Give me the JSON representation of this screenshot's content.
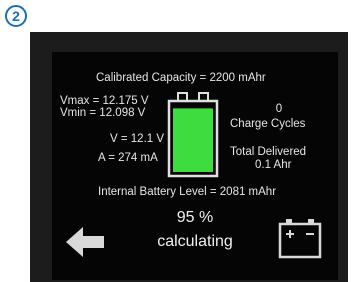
{
  "step_number": "2",
  "screen": {
    "calibrated_capacity": "Calibrated Capacity = 2200 mAhr",
    "vmax": "Vmax = 12.175 V",
    "vmin": "Vmin = 12.098 V",
    "voltage": "V = 12.1 V",
    "current": "A = 274 mA",
    "charge_cycles_count": "0",
    "charge_cycles_label": "Charge Cycles",
    "total_delivered_label": "Total Delivered",
    "total_delivered_value": "0.1 Ahr",
    "internal_level": "Internal Battery Level = 2081 mAhr",
    "percent": "95 %",
    "status": "calculating"
  },
  "battery_gauge": {
    "fill_fraction": 0.95,
    "fill_color": "#3fdc3f",
    "outline_color": "#e0e0e0"
  },
  "icons": {
    "back": "left-arrow-icon",
    "battery_button": "battery-icon"
  }
}
